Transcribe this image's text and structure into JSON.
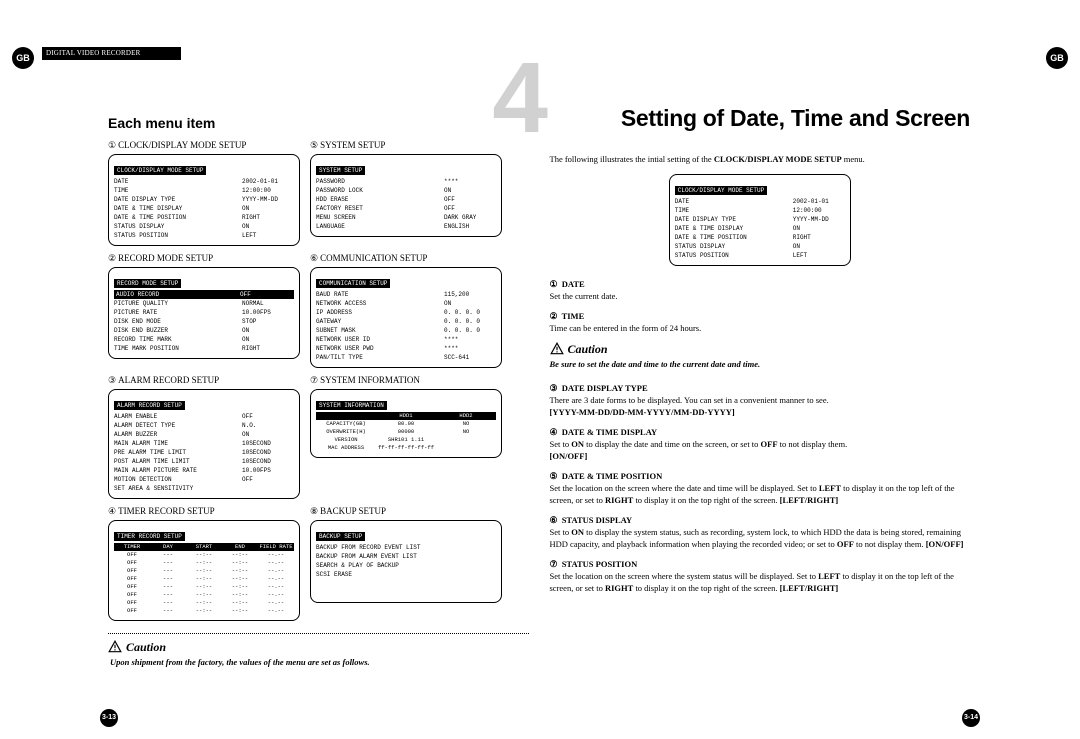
{
  "header": {
    "gb": "GB",
    "product": "DIGITAL VIDEO RECORDER"
  },
  "left_page": {
    "title": "Each menu item",
    "circles": [
      "①",
      "②",
      "③",
      "④",
      "⑤",
      "⑥",
      "⑦",
      "⑧"
    ],
    "menus": [
      {
        "heading": "CLOCK/DISPLAY MODE SETUP",
        "title": "CLOCK/DISPLAY MODE SETUP",
        "rows": [
          [
            "DATE",
            "2002-01-01"
          ],
          [
            "TIME",
            "12:00:00"
          ],
          [
            "DATE DISPLAY TYPE",
            "YYYY-MM-DD"
          ],
          [
            "DATE & TIME DISPLAY",
            "ON"
          ],
          [
            "DATE & TIME POSITION",
            "RIGHT"
          ],
          [
            "STATUS DISPLAY",
            "ON"
          ],
          [
            "STATUS POSITION",
            "LEFT"
          ]
        ]
      },
      {
        "heading": "SYSTEM SETUP",
        "title": "SYSTEM SETUP",
        "rows": [
          [
            "PASSWORD",
            "****"
          ],
          [
            "PASSWORD LOCK",
            "ON"
          ],
          [
            "HDD ERASE",
            "OFF"
          ],
          [
            "FACTORY RESET",
            "OFF"
          ],
          [
            "MENU SCREEN",
            "DARK GRAY"
          ],
          [
            "LANGUAGE",
            "ENGLISH"
          ]
        ]
      },
      {
        "heading": "RECORD MODE SETUP",
        "title": "RECORD MODE SETUP",
        "highlight_row": [
          "AUDIO RECORD",
          "OFF"
        ],
        "rows": [
          [
            "PICTURE QUALITY",
            "NORMAL"
          ],
          [
            "PICTURE RATE",
            "10.00FPS"
          ],
          [
            "DISK END MODE",
            "STOP"
          ],
          [
            "DISK END BUZZER",
            "ON"
          ],
          [
            "RECORD TIME MARK",
            "ON"
          ],
          [
            "TIME MARK POSITION",
            "RIGHT"
          ]
        ]
      },
      {
        "heading": "COMMUNICATION SETUP",
        "title": "COMMUNICATION SETUP",
        "rows": [
          [
            "BAUD RATE",
            "115,200"
          ],
          [
            "NETWORK ACCESS",
            "ON"
          ],
          [
            "IP ADDRESS",
            "0. 0. 0. 0"
          ],
          [
            "GATEWAY",
            "0. 0. 0. 0"
          ],
          [
            "SUBNET MASK",
            "0. 0. 0. 0"
          ],
          [
            "NETWORK USER ID",
            "****"
          ],
          [
            "NETWORK USER PWD",
            "****"
          ],
          [
            "PAN/TILT TYPE",
            "SCC-641"
          ]
        ]
      },
      {
        "heading": "ALARM RECORD SETUP",
        "title": "ALARM RECORD SETUP",
        "rows": [
          [
            "ALARM ENABLE",
            "OFF"
          ],
          [
            "ALARM DETECT TYPE",
            "N.O."
          ],
          [
            "ALARM BUZZER",
            "ON"
          ],
          [
            "MAIN ALARM TIME",
            "10SECOND"
          ],
          [
            "PRE ALARM TIME LIMIT",
            "10SECOND"
          ],
          [
            "POST ALARM TIME LIMIT",
            "10SECOND"
          ],
          [
            "MAIN ALARM PICTURE RATE",
            "10.00FPS"
          ],
          [
            "MOTION DETECTION",
            "OFF"
          ],
          [
            "SET AREA & SENSITIVITY",
            ""
          ]
        ]
      },
      {
        "heading": "SYSTEM INFORMATION",
        "title": "SYSTEM INFORMATION",
        "col_hdr": [
          "",
          "HDD1",
          "HDD2"
        ],
        "trows": [
          [
            "CAPACITY(GB)",
            "80.00",
            "NO"
          ],
          [
            "OVERWRITE(H)",
            "00000",
            "NO"
          ],
          [
            "VERSION",
            "SHR101 1.11",
            ""
          ],
          [
            "MAC ADDRESS",
            "ff-ff-ff-ff-ff-ff",
            ""
          ]
        ]
      },
      {
        "heading": "TIMER RECORD SETUP",
        "title": "TIMER RECORD SETUP",
        "col_hdr": [
          "TIMER",
          "DAY",
          "START",
          "END",
          "FIELD RATE"
        ],
        "trows": [
          [
            "OFF",
            "---",
            "--:--",
            "--:--",
            "--.--"
          ],
          [
            "OFF",
            "---",
            "--:--",
            "--:--",
            "--.--"
          ],
          [
            "OFF",
            "---",
            "--:--",
            "--:--",
            "--.--"
          ],
          [
            "OFF",
            "---",
            "--:--",
            "--:--",
            "--.--"
          ],
          [
            "OFF",
            "---",
            "--:--",
            "--:--",
            "--.--"
          ],
          [
            "OFF",
            "---",
            "--:--",
            "--:--",
            "--.--"
          ],
          [
            "OFF",
            "---",
            "--:--",
            "--:--",
            "--.--"
          ],
          [
            "OFF",
            "---",
            "--:--",
            "--:--",
            "--.--"
          ]
        ]
      },
      {
        "heading": "BACKUP SETUP",
        "title": "BACKUP SETUP",
        "lines": [
          "BACKUP FROM RECORD EVENT LIST",
          "BACKUP FROM ALARM EVENT LIST",
          "SEARCH & PLAY OF BACKUP",
          "SCSI ERASE"
        ]
      }
    ],
    "caution_label": "Caution",
    "caution_text": "Upon shipment from the factory, the values of the menu are set as follows.",
    "page_num": "3-13"
  },
  "right_page": {
    "number": "4",
    "title": "Setting of Date, Time and Screen",
    "intro_pre": "The following illustrates the intial setting of the ",
    "intro_bold": "CLOCK/DISPLAY MODE SETUP",
    "intro_post": " menu.",
    "osd": {
      "title": "CLOCK/DISPLAY MODE SETUP",
      "rows": [
        [
          "DATE",
          "2002-01-01"
        ],
        [
          "TIME",
          "12:00:00"
        ],
        [
          "DATE DISPLAY TYPE",
          "YYYY-MM-DD"
        ],
        [
          "DATE & TIME DISPLAY",
          "ON"
        ],
        [
          "DATE & TIME POSITION",
          "RIGHT"
        ],
        [
          "STATUS DISPLAY",
          "ON"
        ],
        [
          "STATUS POSITION",
          "LEFT"
        ]
      ]
    },
    "circles": [
      "①",
      "②",
      "③",
      "④",
      "⑤",
      "⑥",
      "⑦"
    ],
    "items": [
      {
        "h": "DATE",
        "p": "Set the current date."
      },
      {
        "h": "TIME",
        "p": "Time can be entered in the form of 24 hours."
      }
    ],
    "caution_label": "Caution",
    "caution_note": "Be sure to set the date and time to the current date and time.",
    "items2": [
      {
        "h": "DATE DISPLAY TYPE",
        "p": "There are 3 date forms to be displayed. You can set in a convenient manner to see.",
        "b": "[YYYY-MM-DD/DD-MM-YYYY/MM-DD-YYYY]"
      },
      {
        "h": "DATE & TIME DISPLAY",
        "p_pre": "Set to ",
        "b1": "ON",
        "p_mid1": " to display the date and time on the screen, or set to ",
        "b2": "OFF",
        "p_mid2": " to not display them.",
        "tail": "[ON/OFF]"
      },
      {
        "h": "DATE & TIME POSITION",
        "p_pre": "Set the location on the screen where the date and time will be displayed. Set to ",
        "b1": "LEFT",
        "p_mid1": " to display it on the top left of the screen, or set to ",
        "b2": "RIGHT",
        "p_mid2": " to display it on the top right of the screen. ",
        "tail": "[LEFT/RIGHT]"
      },
      {
        "h": "STATUS DISPLAY",
        "p_pre": "Set to ",
        "b1": "ON",
        "p_mid1": " to display the system status, such as recording, system lock, to which HDD the data is being stored, remaining HDD capacity, and playback information when playing the recorded video; or set to ",
        "b2": "OFF",
        "p_mid2": " to not display them. ",
        "tail": "[ON/OFF]"
      },
      {
        "h": "STATUS POSITION",
        "p_pre": "Set the location on the screen where the system status will be displayed. Set to ",
        "b1": "LEFT",
        "p_mid1": " to display it on the top left of the screen, or set to ",
        "b2": "RIGHT",
        "p_mid2": " to display it on the top right of the screen. ",
        "tail": "[LEFT/RIGHT]"
      }
    ],
    "page_num": "3-14"
  }
}
